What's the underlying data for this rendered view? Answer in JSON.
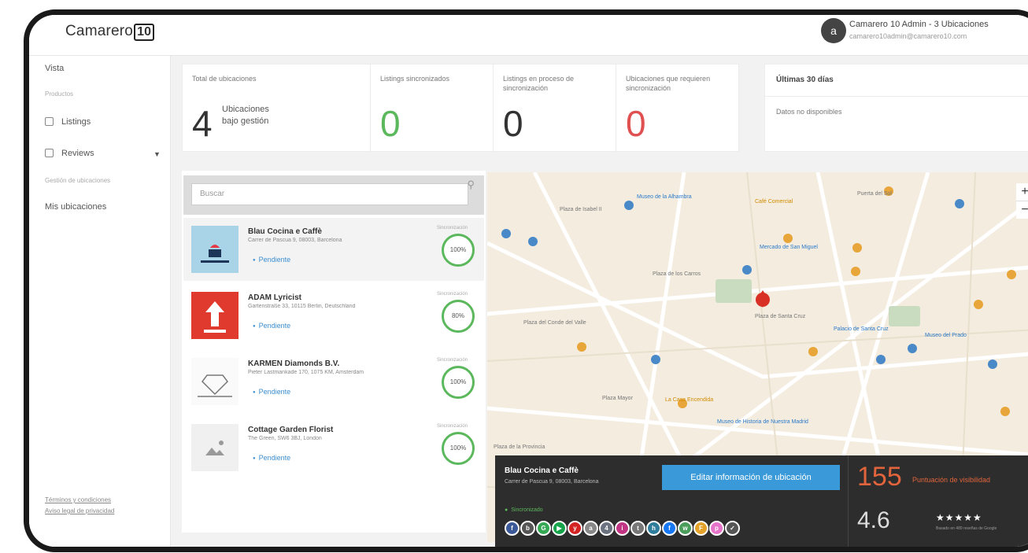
{
  "app": {
    "logo_text": "Camarero",
    "logo_badge": "10"
  },
  "user": {
    "avatar_initial": "a",
    "name": "Camarero 10 Admin - 3 Ubicaciones",
    "email": "camarero10admin@camarero10.com"
  },
  "sidebar": {
    "vista": "Vista",
    "section_1": "Productos",
    "items": [
      {
        "label": "Listings"
      },
      {
        "label": "Reviews"
      }
    ],
    "section_2": "Gestión de ubicaciones",
    "mis_ubicaciones": "Mis ubicaciones",
    "footer_links": [
      "Términos y condiciones",
      "Aviso legal de privacidad"
    ]
  },
  "stats": [
    {
      "label": "Total de ubicaciones",
      "value": "4",
      "sub": "Ubicaciones bajo gestión",
      "color": "#333333"
    },
    {
      "label": "Listings sincronizados",
      "value": "0",
      "sub": "",
      "color": "#5cb85c"
    },
    {
      "label": "Listings en proceso de sincronización",
      "value": "0",
      "sub": "",
      "color": "#333333"
    },
    {
      "label": "Ubicaciones que requieren sincronización",
      "value": "0",
      "sub": "",
      "color": "#e05050"
    }
  ],
  "recent": {
    "title": "Últimas 30 días",
    "empty_text": "Datos no disponibles"
  },
  "search": {
    "placeholder": "Buscar",
    "icon": "search-icon"
  },
  "locations": [
    {
      "name": "Blau Cocina e Caffè",
      "address": "Carrer de Pascua 9, 08003, Barcelona",
      "status": "Pendiente",
      "score_label": "Sincronización",
      "score": "100%"
    },
    {
      "name": "ADAM Lyricist",
      "address": "Gartenstraße 33, 10115 Berlin, Deutschland",
      "status": "Pendiente",
      "score_label": "Sincronización",
      "score": "80%"
    },
    {
      "name": "KARMEN Diamonds B.V.",
      "address": "Pieter Lastmankade 170, 1075 KM, Amsterdam",
      "status": "Pendiente",
      "score_label": "Sincronización",
      "score": "100%"
    },
    {
      "name": "Cottage Garden Florist",
      "address": "The Green, SW6 3BJ, London",
      "status": "Pendiente",
      "score_label": "Sincronización",
      "score": "100%"
    }
  ],
  "map": {
    "zoom_in": "+",
    "zoom_out": "−",
    "labels": [
      {
        "text": "Plaza de Isabel II",
        "kind": "plain"
      },
      {
        "text": "Plaza de los Carros",
        "kind": "plain"
      },
      {
        "text": "Plaza del Conde del Valle",
        "kind": "plain"
      },
      {
        "text": "Plaza de Santa Cruz",
        "kind": "plain"
      },
      {
        "text": "Plaza de la Provincia",
        "kind": "plain"
      },
      {
        "text": "Museo de la Alhambra",
        "kind": "blue"
      },
      {
        "text": "Mercado de San Miguel",
        "kind": "blue"
      },
      {
        "text": "Museo del Prado",
        "kind": "blue"
      },
      {
        "text": "Museo de Historia de Nuestra Madrid",
        "kind": "blue"
      },
      {
        "text": "Café Comercial",
        "kind": "orange"
      },
      {
        "text": "La Casa Encendida",
        "kind": "orange"
      },
      {
        "text": "Plaza Mayor",
        "kind": "plain"
      },
      {
        "text": "Puerta del Sol",
        "kind": "plain"
      },
      {
        "text": "Palacio de Santa Cruz",
        "kind": "blue"
      }
    ]
  },
  "infobar": {
    "name": "Blau Cocina e Caffè",
    "address": "Carrer de Pascua 9, 08003, Barcelona",
    "edit_button": "Editar información de ubicación",
    "status": "Sincronizado",
    "score": "155",
    "score_label": "Puntuación de visibilidad",
    "rating": "4.6",
    "stars": "★★★★★",
    "reviews_label": "Basado en 489 reseñas de Google",
    "social_icons": [
      {
        "name": "facebook-icon",
        "glyph": "f",
        "color": "#3b5998"
      },
      {
        "name": "bing-icon",
        "glyph": "b",
        "color": "#555555"
      },
      {
        "name": "google-icon",
        "glyph": "G",
        "color": "#34a853"
      },
      {
        "name": "play-icon",
        "glyph": "▶",
        "color": "#16a34a"
      },
      {
        "name": "yelp-icon",
        "glyph": "y",
        "color": "#d32323"
      },
      {
        "name": "apple-icon",
        "glyph": "a",
        "color": "#888888"
      },
      {
        "name": "foursquare-icon",
        "glyph": "4",
        "color": "#6b7280"
      },
      {
        "name": "instagram-icon",
        "glyph": "i",
        "color": "#c13584"
      },
      {
        "name": "tripadvisor-icon",
        "glyph": "t",
        "color": "#777777"
      },
      {
        "name": "here-icon",
        "glyph": "h",
        "color": "#2f7d9c"
      },
      {
        "name": "facebook-2-icon",
        "glyph": "f",
        "color": "#1877f2"
      },
      {
        "name": "waze-icon",
        "glyph": "w",
        "color": "#4a9d5a"
      },
      {
        "name": "foursquare-2-icon",
        "glyph": "F",
        "color": "#e5a22b"
      },
      {
        "name": "pinterest-icon",
        "glyph": "p",
        "color": "#e573c9"
      },
      {
        "name": "check-icon",
        "glyph": "✓",
        "color": "#555555"
      }
    ]
  }
}
